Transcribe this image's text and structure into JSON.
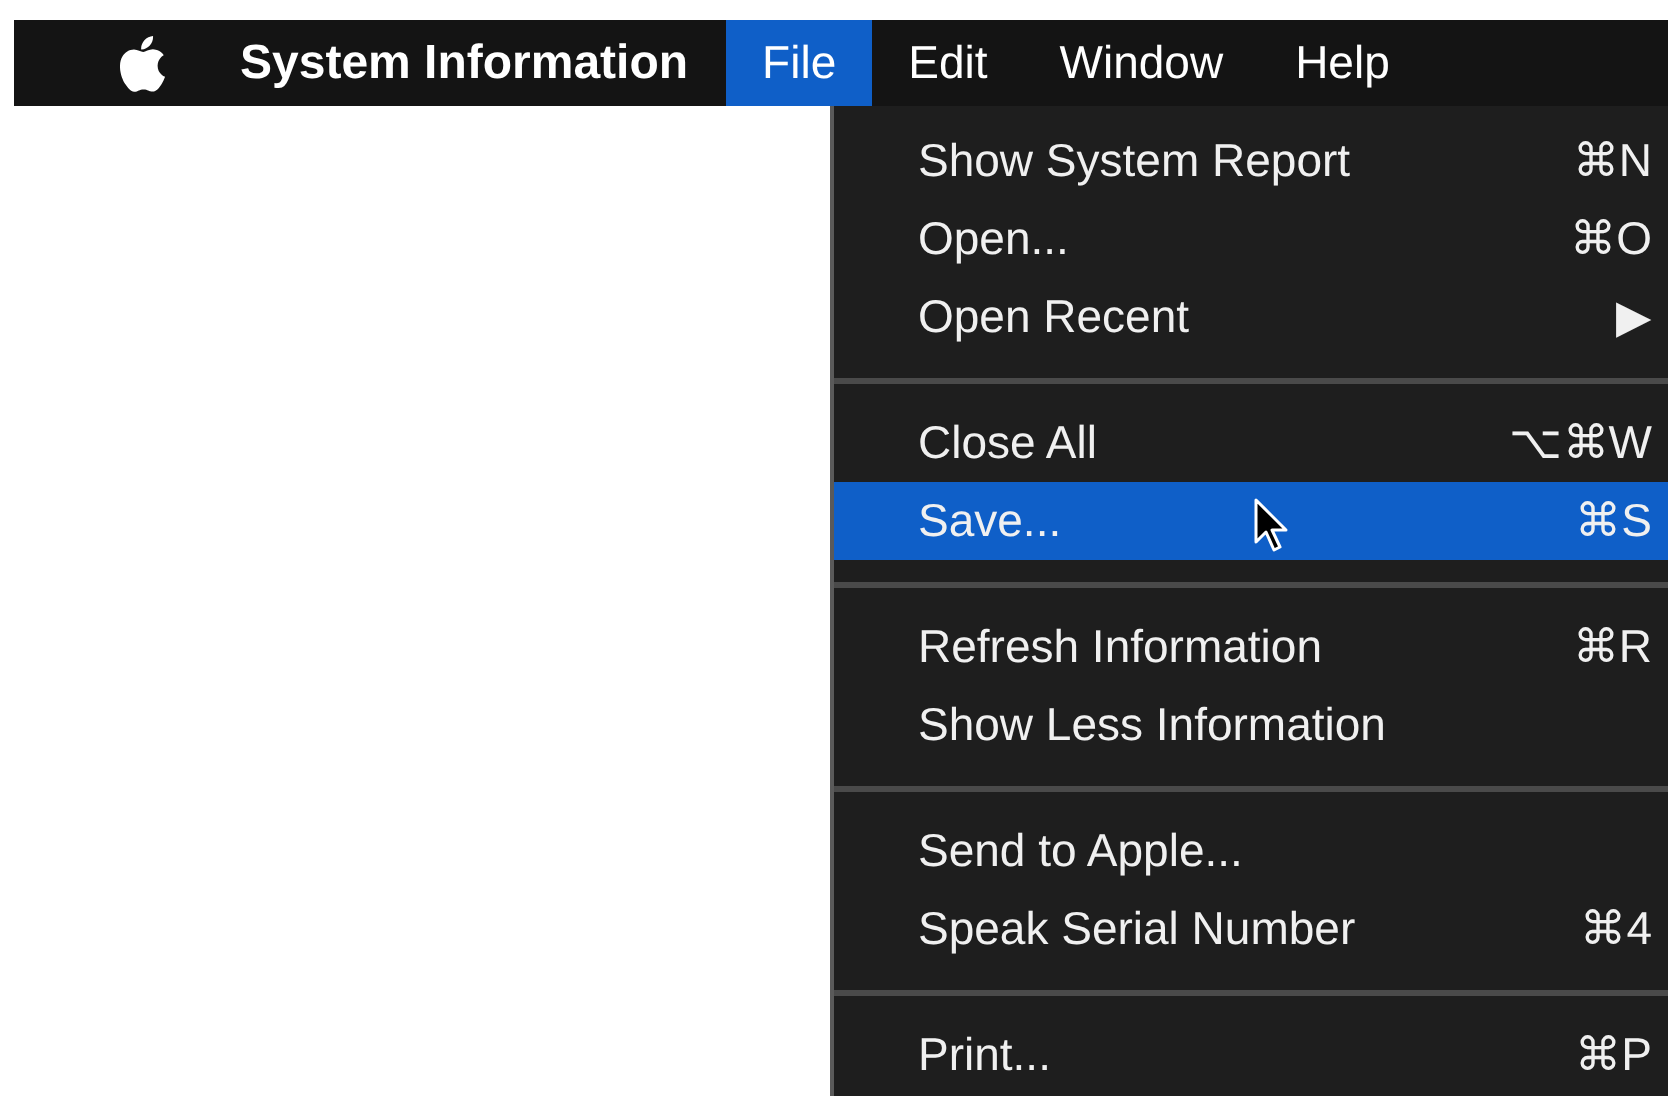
{
  "menu_bar": {
    "app_name": "System Information",
    "menus": [
      {
        "label": "File",
        "selected": true
      },
      {
        "label": "Edit",
        "selected": false
      },
      {
        "label": "Window",
        "selected": false
      },
      {
        "label": "Help",
        "selected": false
      }
    ]
  },
  "file_menu": {
    "items": [
      {
        "kind": "item",
        "label": "Show System Report",
        "shortcut": "⌘N",
        "selected": false
      },
      {
        "kind": "item",
        "label": "Open...",
        "shortcut": "⌘O",
        "selected": false
      },
      {
        "kind": "item",
        "label": "Open Recent",
        "shortcut": "▶",
        "selected": false
      },
      {
        "kind": "separator"
      },
      {
        "kind": "item",
        "label": "Close All",
        "shortcut": "⌥⌘W",
        "selected": false
      },
      {
        "kind": "item",
        "label": "Save...",
        "shortcut": "⌘S",
        "selected": true
      },
      {
        "kind": "separator"
      },
      {
        "kind": "item",
        "label": "Refresh Information",
        "shortcut": "⌘R",
        "selected": false
      },
      {
        "kind": "item",
        "label": "Show Less Information",
        "selected": false
      },
      {
        "kind": "separator"
      },
      {
        "kind": "item",
        "label": "Send to Apple...",
        "selected": false
      },
      {
        "kind": "item",
        "label": "Speak Serial Number",
        "shortcut": "⌘4",
        "selected": false
      },
      {
        "kind": "separator"
      },
      {
        "kind": "item",
        "label": "Print...",
        "shortcut": "⌘P",
        "selected": false
      }
    ]
  }
}
